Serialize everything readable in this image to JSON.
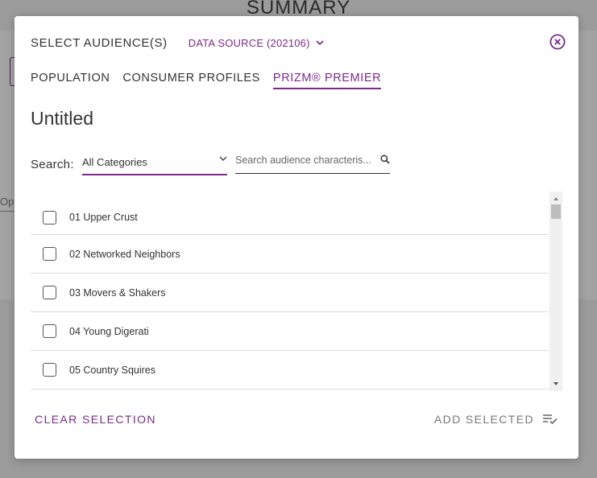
{
  "background": {
    "title": "SUMMARY",
    "edge_text": "Opt"
  },
  "modal": {
    "title": "SELECT AUDIENCE(S)",
    "data_source_label": "DATA SOURCE (202106)",
    "tabs": [
      {
        "label": "POPULATION",
        "active": false
      },
      {
        "label": "CONSUMER PROFILES",
        "active": false
      },
      {
        "label": "PRIZM® PREMIER",
        "active": true
      }
    ],
    "audience_name": "Untitled",
    "search": {
      "label": "Search:",
      "category_value": "All Categories",
      "placeholder": "Search audience characteris..."
    },
    "items": [
      {
        "label": "01 Upper Crust",
        "checked": false
      },
      {
        "label": "02 Networked Neighbors",
        "checked": false
      },
      {
        "label": "03 Movers & Shakers",
        "checked": false
      },
      {
        "label": "04 Young Digerati",
        "checked": false
      },
      {
        "label": "05 Country Squires",
        "checked": false
      }
    ],
    "footer": {
      "clear_label": "CLEAR SELECTION",
      "add_label": "ADD SELECTED"
    }
  },
  "colors": {
    "accent": "#7b2a8a",
    "text": "#333333",
    "muted": "#777777",
    "overlay": "#9b9b9b"
  },
  "icons": [
    "chevron-down-icon",
    "close-circle-icon",
    "search-icon",
    "add-list-check-icon",
    "scroll-up-arrow-icon",
    "scroll-down-arrow-icon"
  ]
}
